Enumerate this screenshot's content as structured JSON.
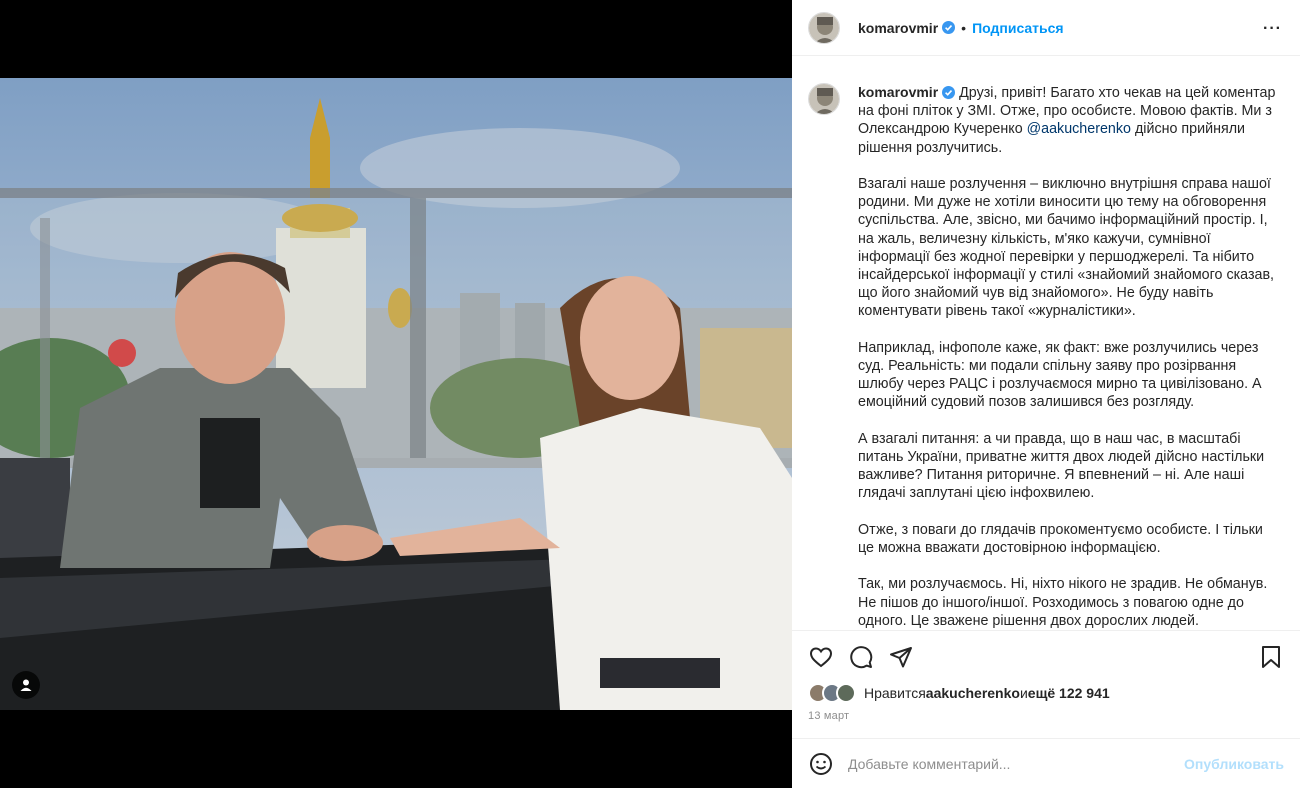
{
  "post": {
    "username": "komarovmir",
    "separator": "•",
    "follow_label": "Подписаться",
    "more_label": "···"
  },
  "caption": {
    "username": "komarovmir",
    "p1_before": " Друзі, привіт! Багато хто чекав на цей коментар на фоні пліток у ЗМІ. Отже, про особисте. Мовою фактів. Ми з Олександрою Кучеренко ",
    "mention": "@aakucherenko",
    "p1_after": " дійсно прийняли рішення розлучитись.",
    "p2": "Взагалі наше розлучення – виключно внутрішня справа нашої родини. Ми дуже не хотіли виносити цю тему на обговорення суспільства. Але, звісно, ми бачимо інформаційний простір. І, на жаль, величезну кількість, м'яко кажучи, сумнівної інформації без жодної перевірки у першоджерелі. Та нібито інсайдерської інформації у стилі «знайомий знайомого сказав, що його знайомий чув від знайомого». Не буду навіть коментувати рівень такої «журналістики».",
    "p3": "Наприклад, інфополе каже, як факт: вже розлучились через суд. Реальність: ми подали спільну заяву про розірвання шлюбу через РАЦС і розлучаємося мирно та цивілізовано. А емоційний судовий позов залишився без розгляду.",
    "p4": "А взагалі питання: а чи правда, що в наш час, в масштабі питань України, приватне життя двох людей дійсно настільки важливе? Питання риторичне. Я впевнений – ні. Але наші глядачі заплутані цією інфохвилею.",
    "p5": "Отже, з поваги до глядачів прокоментуємо особисте. І тільки це можна вважати достовірною інформацією.",
    "p6": "Так, ми розлучаємось. Ні, ніхто нікого не зрадив. Не обманув. Не пішов до іншого/іншої. Розходимось з повагою одне до одного. Це зважене рішення двох дорослих людей."
  },
  "likes": {
    "prefix": "Нравится ",
    "user": "aakucherenko",
    "middle": " и ",
    "count": "ещё 122 941"
  },
  "date": "13 март",
  "comment_box": {
    "placeholder": "Добавьте комментарий...",
    "publish_label": "Опубликовать"
  },
  "colors": {
    "accent": "#0095f6",
    "verified": "#3897f0",
    "mention": "#00376b",
    "publish_disabled": "#b2dffc"
  },
  "icons": [
    "heart-icon",
    "comment-icon",
    "share-icon",
    "bookmark-icon",
    "emoji-icon",
    "verified-icon",
    "more-icon",
    "user-tag-icon"
  ]
}
